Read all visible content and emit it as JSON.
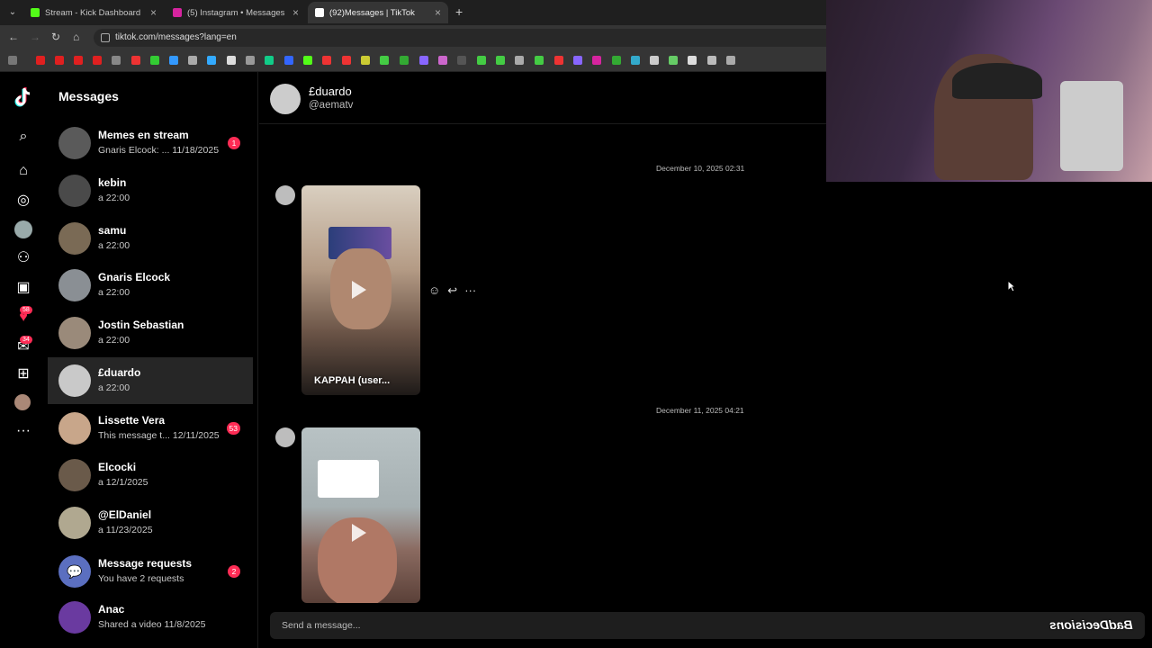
{
  "browser": {
    "tabs": [
      {
        "title": "Stream - Kick Dashboard",
        "favicon_color": "#53fc18"
      },
      {
        "title": "(5) Instagram • Messages",
        "favicon_color": "#d6249f"
      },
      {
        "title": "(92)Messages | TikTok",
        "favicon_color": "#ffffff"
      }
    ],
    "url": "tiktok.com/messages?lang=en"
  },
  "rail": {
    "badges": {
      "notifications": "58",
      "messages": "34"
    }
  },
  "sidebar": {
    "title": "Messages",
    "conversations": [
      {
        "name": "Memes en stream",
        "sub": "Gnaris Elcock: ...  11/18/2025",
        "count": "1"
      },
      {
        "name": "kebin",
        "sub": "a 22:00",
        "count": ""
      },
      {
        "name": "samu",
        "sub": "a 22:00",
        "count": ""
      },
      {
        "name": "Gnaris Elcock",
        "sub": "a 22:00",
        "count": ""
      },
      {
        "name": "Jostin Sebastian",
        "sub": "a 22:00",
        "count": ""
      },
      {
        "name": "£duardo",
        "sub": "a 22:00",
        "count": ""
      },
      {
        "name": "Lissette Vera",
        "sub": "This message t... 12/11/2025",
        "count": "53"
      },
      {
        "name": "Elcocki",
        "sub": "a 12/1/2025",
        "count": ""
      },
      {
        "name": "@ElDaniel",
        "sub": "a 11/23/2025",
        "count": ""
      },
      {
        "name": "Message requests",
        "sub": "You have 2 requests",
        "count": "2"
      },
      {
        "name": "Anac",
        "sub": "Shared a video 11/8/2025",
        "count": ""
      }
    ]
  },
  "chat": {
    "name": "£duardo",
    "handle": "@aematv",
    "messages": [
      {
        "timestamp": "December 10, 2025 02:31",
        "caption": "KAPPAH (user..."
      },
      {
        "timestamp": "December 11, 2025 04:21",
        "caption": ""
      }
    ],
    "composer_placeholder": "Send a message..."
  },
  "watermark": "BadDecisions"
}
